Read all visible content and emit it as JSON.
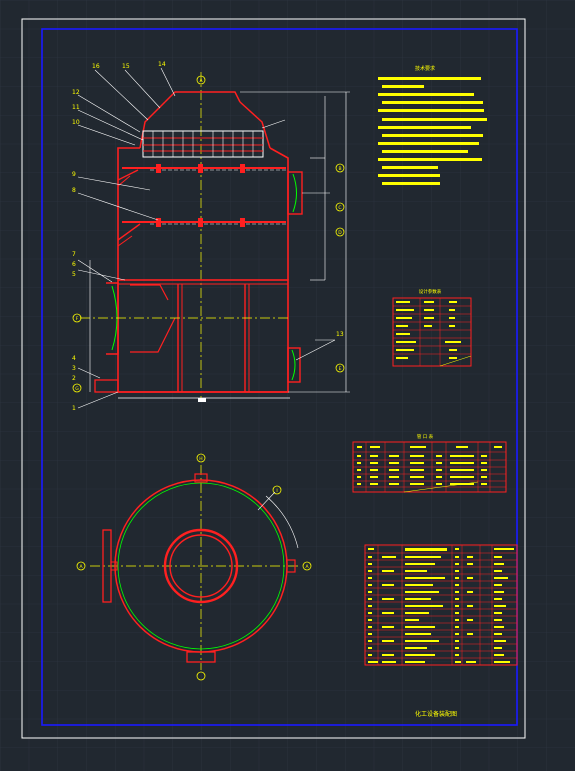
{
  "drawing": {
    "background": "#212830",
    "grid_color": "#2c3440",
    "sheet_color": "#ffffff",
    "border_color": "#1a1aff",
    "title_block_text": "化工设备装配图",
    "notes_title": "技术要求",
    "design_table_title": "设计参数表",
    "nozzle_table_title": "管 口 表",
    "part_labels": [
      "16",
      "15",
      "14",
      "12",
      "11",
      "10",
      "9",
      "8",
      "7",
      "6",
      "5",
      "4",
      "3",
      "2",
      "1",
      "13"
    ],
    "nozzle_labels": [
      "A",
      "B",
      "C",
      "D",
      "E",
      "F",
      "G",
      "H",
      "I"
    ],
    "section_labels": [
      "A",
      "A"
    ]
  },
  "colors": {
    "vessel": "#ff2020",
    "center": "#ffff00",
    "annotation": "#ffffff",
    "table": "#ff2020",
    "text": "#ffff00",
    "green": "#00ff00",
    "dim": "#ffffff"
  }
}
